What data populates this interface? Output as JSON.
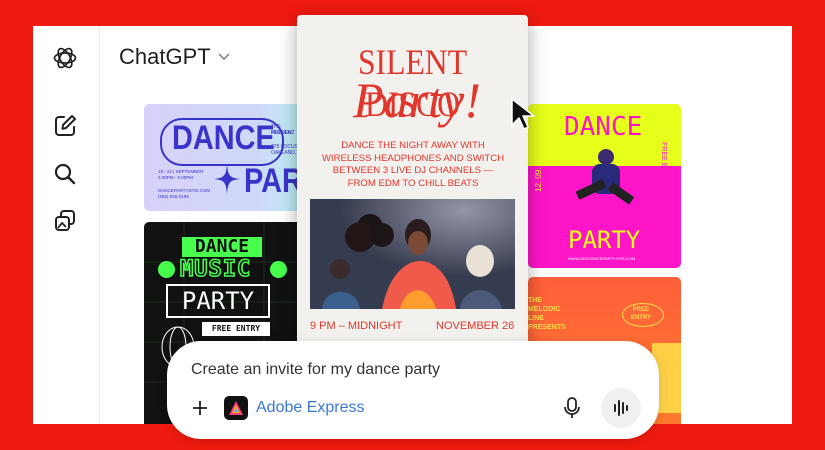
{
  "app": {
    "title": "ChatGPT"
  },
  "colors": {
    "brand_red": "#ee1a0f",
    "card_red": "#d93a32",
    "lime": "#e6ff1a",
    "magenta": "#ff15c8",
    "lavender": "#d7d2fb",
    "blue_purple": "#3a33c9",
    "green": "#48ff4d"
  },
  "sidebar": {
    "icons": [
      "openai-logo-icon",
      "new-chat-icon",
      "search-icon",
      "images-icon"
    ]
  },
  "card_blue": {
    "heading_1": "DANCE",
    "heading_2": "PAR",
    "small_1": "THE MELODIC",
    "small_2": "PRESENT",
    "addr_1": "778 LOCUST",
    "addr_2": "OAKLAND, S",
    "date_1": "19 - 22  |  SEPTEMBER",
    "date_2": "3.30PM - 9.00PM",
    "site": "DANCEPARTYSITE.COM",
    "phone": "(555) 555-0199"
  },
  "card_green": {
    "line_1": "DANCE",
    "line_2": "MUSIC",
    "line_3": "PARTY",
    "badge": "FREE ENTRY"
  },
  "card_main": {
    "title_1": "SILENT DISCO",
    "title_2": "Party!",
    "description": "DANCE THE NIGHT AWAY WITH WIRELESS HEADPHONES AND SWITCH BETWEEN 3 LIVE DJ CHANNELS — FROM EDM TO CHILL BEATS",
    "time": "9 PM – MIDNIGHT",
    "date": "NOVEMBER 26"
  },
  "card_yellow": {
    "top": "DANCE",
    "bottom": "PARTY",
    "date": "12. 09. 20",
    "side": "FREE ENTRY",
    "site": "WWW.DESCENCEPARTY.SITE.COM"
  },
  "card_orange": {
    "text_1": "THE",
    "text_2": "MELODIC",
    "text_3": "LINE",
    "text_4": "PRESENTS",
    "badge_1": "FREE",
    "badge_2": "ENTRY"
  },
  "composer": {
    "prompt": "Create an invite for my dance party",
    "tool_label": "Adobe Express"
  }
}
